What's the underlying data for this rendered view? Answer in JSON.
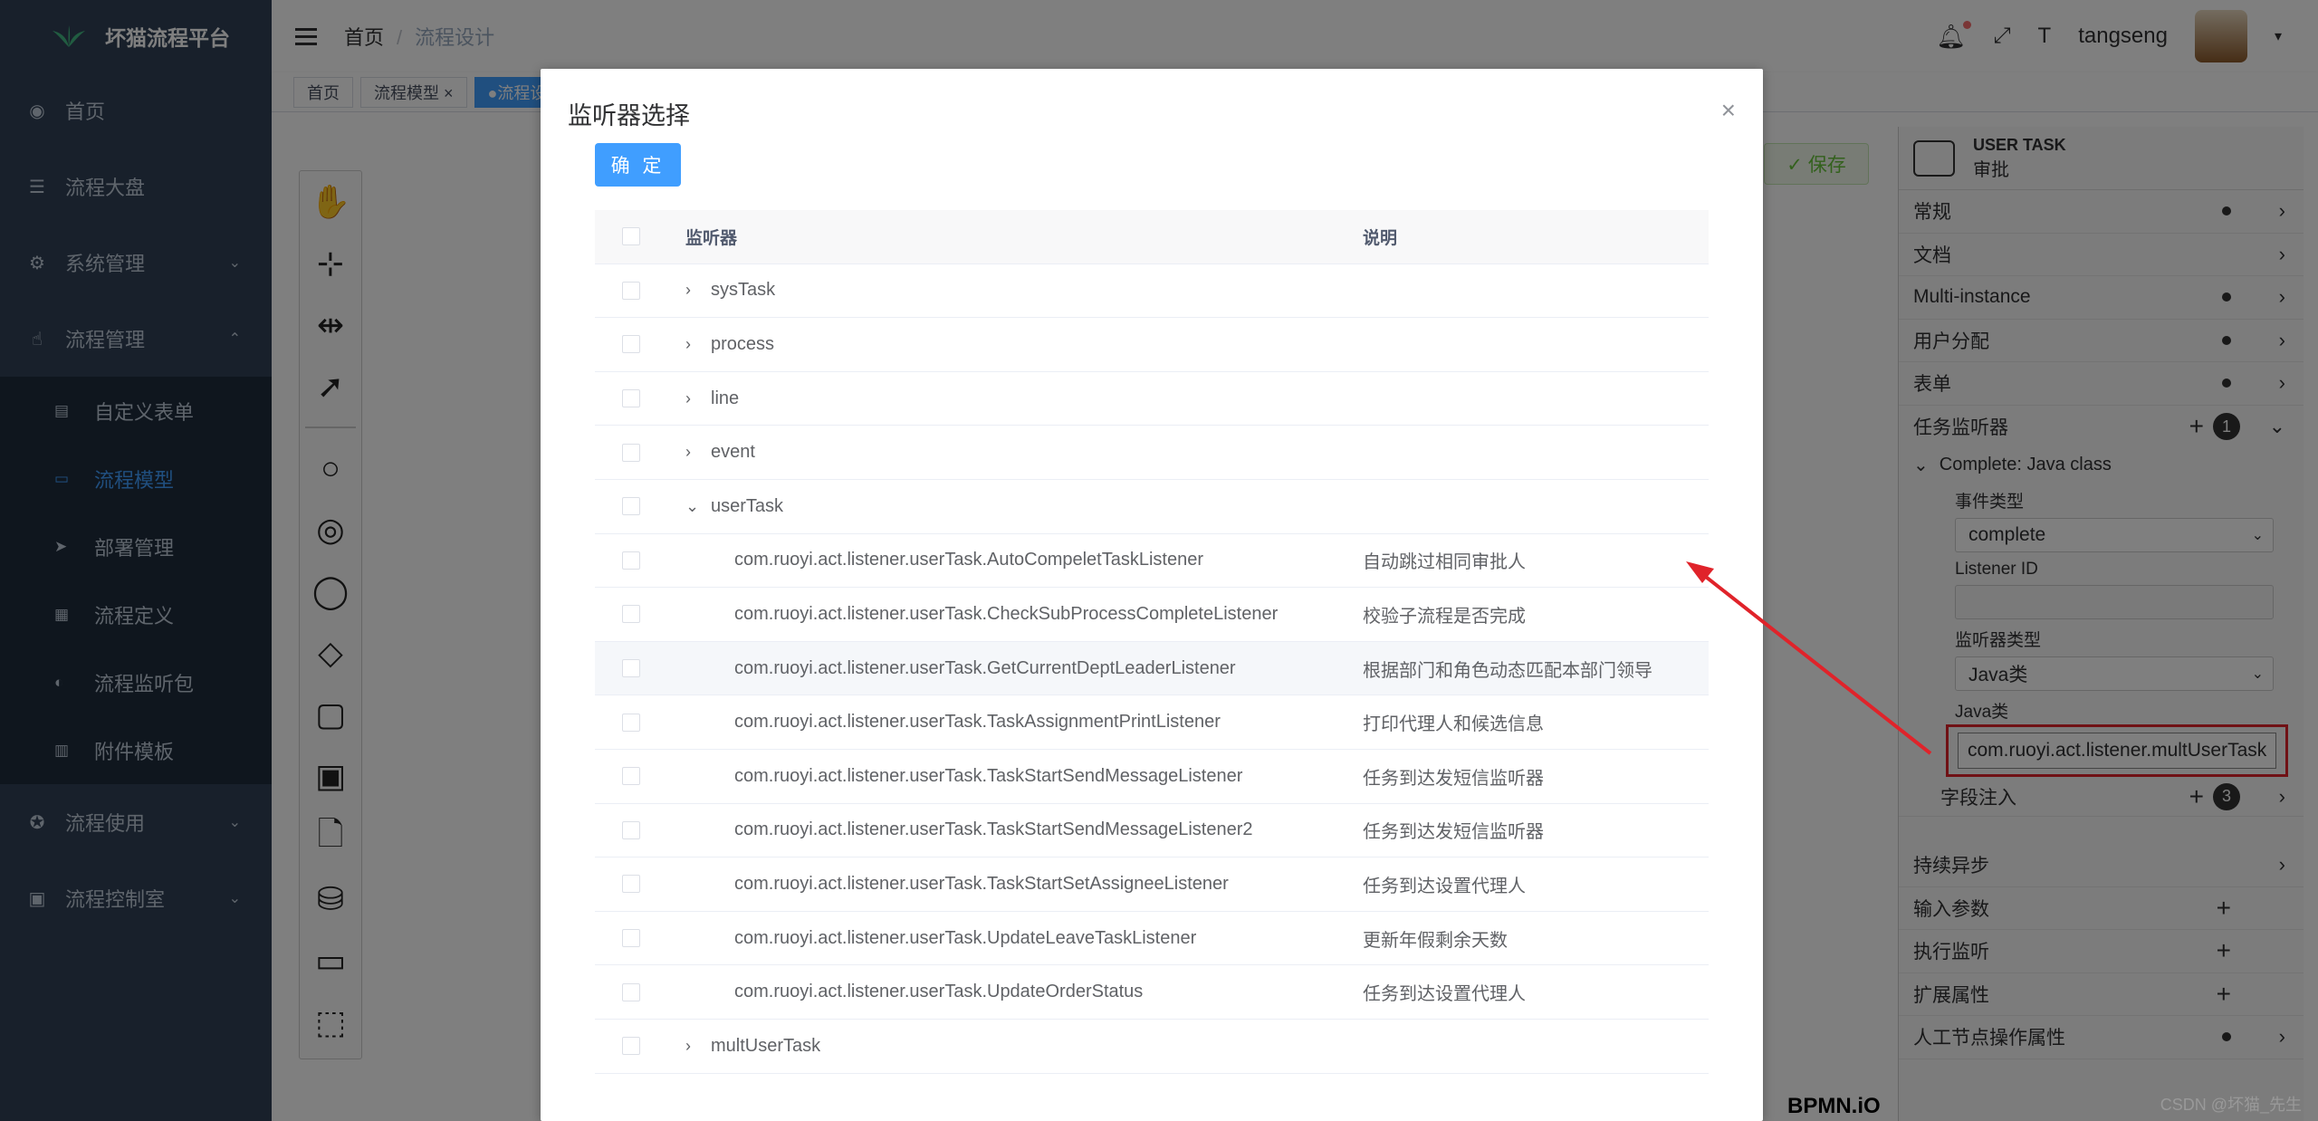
{
  "app": {
    "title": "坏猫流程平台"
  },
  "sidebar": {
    "items": [
      {
        "label": "首页",
        "icon": "dashboard-icon"
      },
      {
        "label": "流程大盘",
        "icon": "list-icon"
      },
      {
        "label": "系统管理",
        "icon": "gear-icon",
        "arrow": "down"
      },
      {
        "label": "流程管理",
        "icon": "thumb-icon",
        "arrow": "up"
      }
    ],
    "sub_items": [
      {
        "label": "自定义表单"
      },
      {
        "label": "流程模型",
        "active": true
      },
      {
        "label": "部署管理"
      },
      {
        "label": "流程定义"
      },
      {
        "label": "流程监听包"
      },
      {
        "label": "附件模板"
      }
    ],
    "bottom_items": [
      {
        "label": "流程使用"
      },
      {
        "label": "流程控制室"
      }
    ]
  },
  "header": {
    "breadcrumb": [
      "首页",
      "流程设计"
    ],
    "user": "tangseng"
  },
  "tags": [
    {
      "label": "首页"
    },
    {
      "label": "流程模型 ×"
    },
    {
      "label": "●流程设"
    }
  ],
  "toolbar": {
    "save_label": "✓ 保存"
  },
  "canvas": {
    "watermark": "BPMN.iO"
  },
  "props": {
    "type": "USER TASK",
    "name": "审批",
    "groups": [
      "常规",
      "文档",
      "Multi-instance",
      "用户分配",
      "表单",
      "任务监听器"
    ],
    "listener_count": "1",
    "listener_title": "Complete: Java class",
    "event_type_label": "事件类型",
    "event_type": "complete",
    "listener_id_label": "Listener ID",
    "listener_type_label": "监听器类型",
    "listener_type": "Java类",
    "java_class_label": "Java类",
    "java_class": "com.ruoyi.act.listener.multUserTask",
    "field_inject_label": "字段注入",
    "field_inject_count": "3",
    "bottom_groups": [
      "持续异步",
      "输入参数",
      "执行监听",
      "扩展属性",
      "人工节点操作属性"
    ]
  },
  "dialog": {
    "title": "监听器选择",
    "ok_label": "确 定",
    "headers": {
      "name": "监听器",
      "desc": "说明"
    },
    "rows": [
      {
        "name": "sysTask",
        "desc": "",
        "level": 1,
        "exp": "›"
      },
      {
        "name": "process",
        "desc": "",
        "level": 1,
        "exp": "›"
      },
      {
        "name": "line",
        "desc": "",
        "level": 1,
        "exp": "›"
      },
      {
        "name": "event",
        "desc": "",
        "level": 1,
        "exp": "›"
      },
      {
        "name": "userTask",
        "desc": "",
        "level": 1,
        "exp": "⌄"
      },
      {
        "name": "com.ruoyi.act.listener.userTask.AutoCompeletTaskListener",
        "desc": "自动跳过相同审批人",
        "level": 2
      },
      {
        "name": "com.ruoyi.act.listener.userTask.CheckSubProcessCompleteListener",
        "desc": "校验子流程是否完成",
        "level": 2
      },
      {
        "name": "com.ruoyi.act.listener.userTask.GetCurrentDeptLeaderListener",
        "desc": "根据部门和角色动态匹配本部门领导",
        "level": 2,
        "hl": true
      },
      {
        "name": "com.ruoyi.act.listener.userTask.TaskAssignmentPrintListener",
        "desc": "打印代理人和候选信息",
        "level": 2
      },
      {
        "name": "com.ruoyi.act.listener.userTask.TaskStartSendMessageListener",
        "desc": "任务到达发短信监听器",
        "level": 2
      },
      {
        "name": "com.ruoyi.act.listener.userTask.TaskStartSendMessageListener2",
        "desc": "任务到达发短信监听器",
        "level": 2
      },
      {
        "name": "com.ruoyi.act.listener.userTask.TaskStartSetAssigneeListener",
        "desc": "任务到达设置代理人",
        "level": 2
      },
      {
        "name": "com.ruoyi.act.listener.userTask.UpdateLeaveTaskListener",
        "desc": "更新年假剩余天数",
        "level": 2
      },
      {
        "name": "com.ruoyi.act.listener.userTask.UpdateOrderStatus",
        "desc": "任务到达设置代理人",
        "level": 2
      },
      {
        "name": "multUserTask",
        "desc": "",
        "level": 1,
        "exp": "›"
      }
    ]
  },
  "watermark": "CSDN @坏猫_先生",
  "colors": {
    "accent": "#409eff",
    "sidebar": "#304156",
    "highlight": "#e0232a"
  }
}
